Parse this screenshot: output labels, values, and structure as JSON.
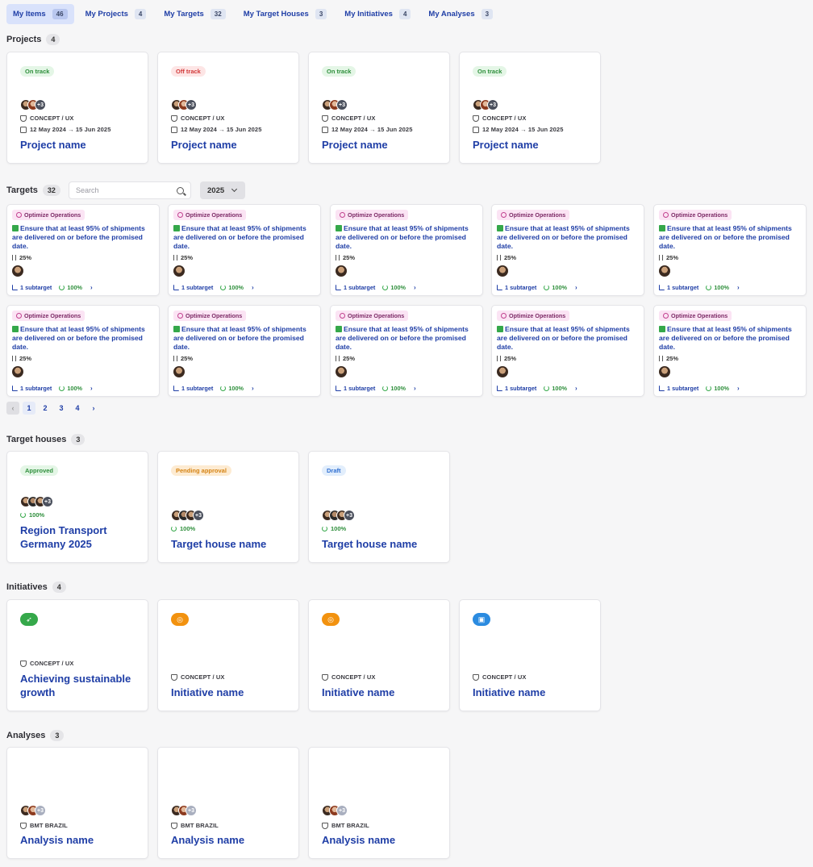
{
  "tabs": [
    {
      "label": "My Items",
      "count": "46"
    },
    {
      "label": "My Projects",
      "count": "4"
    },
    {
      "label": "My Targets",
      "count": "32"
    },
    {
      "label": "My Target Houses",
      "count": "3"
    },
    {
      "label": "My Initiatives",
      "count": "4"
    },
    {
      "label": "My Analyses",
      "count": "3"
    }
  ],
  "projects": {
    "heading": "Projects",
    "count": "4",
    "items": [
      {
        "status": "On track",
        "more": "+3",
        "category": "CONCEPT / UX",
        "dates": "12 May 2024 → 15 Jun 2025",
        "name": "Project name"
      },
      {
        "status": "Off track",
        "more": "+3",
        "category": "CONCEPT / UX",
        "dates": "12 May 2024 → 15 Jun 2025",
        "name": "Project name"
      },
      {
        "status": "On track",
        "more": "+3",
        "category": "CONCEPT / UX",
        "dates": "12 May 2024 → 15 Jun 2025",
        "name": "Project name"
      },
      {
        "status": "On track",
        "more": "+3",
        "category": "CONCEPT / UX",
        "dates": "12 May 2024 → 15 Jun 2025",
        "name": "Project name"
      }
    ]
  },
  "targets": {
    "heading": "Targets",
    "count": "32",
    "search_placeholder": "Search",
    "year": "2025",
    "card": {
      "category": "Optimize Operations",
      "text": "Ensure that at least 95% of shipments are delivered on or before the promised date.",
      "progress": "25%",
      "subtargets": "1 subtarget",
      "completion": "100%",
      "arrow": "›"
    },
    "pagination": {
      "prev": "‹",
      "pages": [
        "1",
        "2",
        "3",
        "4"
      ],
      "next": "›"
    }
  },
  "target_houses": {
    "heading": "Target houses",
    "count": "3",
    "items": [
      {
        "status": "Approved",
        "more": "+3",
        "completion": "100%",
        "name": "Region Transport Germany 2025"
      },
      {
        "status": "Pending approval",
        "more": "+3",
        "completion": "100%",
        "name": "Target house name"
      },
      {
        "status": "Draft",
        "more": "+3",
        "completion": "100%",
        "name": "Target house name"
      }
    ]
  },
  "initiatives": {
    "heading": "Initiatives",
    "count": "4",
    "items": [
      {
        "icon": "rocket-icon",
        "category": "CONCEPT / UX",
        "name": "Achieving sustainable growth"
      },
      {
        "icon": "target-icon",
        "category": "CONCEPT / UX",
        "name": "Initiative name"
      },
      {
        "icon": "target-icon",
        "category": "CONCEPT / UX",
        "name": "Initiative name"
      },
      {
        "icon": "briefcase-icon",
        "category": "CONCEPT / UX",
        "name": "Initiative name"
      }
    ]
  },
  "analyses": {
    "heading": "Analyses",
    "count": "3",
    "items": [
      {
        "more": "+3",
        "category": "BMT BRAZIL",
        "name": "Analysis name"
      },
      {
        "more": "+3",
        "category": "BMT BRAZIL",
        "name": "Analysis name"
      },
      {
        "more": "+3",
        "category": "BMT BRAZIL",
        "name": "Analysis name"
      }
    ]
  }
}
